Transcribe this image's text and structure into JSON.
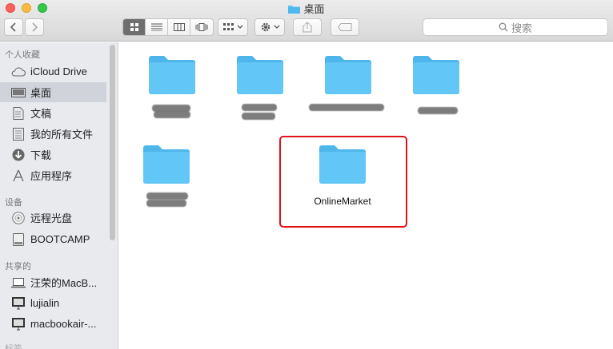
{
  "window": {
    "title": "桌面"
  },
  "toolbar": {
    "back_icon": "chevron-left-icon",
    "forward_icon": "chevron-right-icon",
    "view_icons": [
      "icon-view-icon",
      "list-view-icon",
      "column-view-icon",
      "cover-flow-icon"
    ],
    "arrange_icon": "arrange-grid-icon",
    "action_icon": "gear-icon",
    "share_icon": "share-icon",
    "tag_icon": "tag-icon",
    "search_placeholder": "搜索"
  },
  "sidebar": {
    "favorites_heading": "个人收藏",
    "favorites": [
      {
        "label": "iCloud Drive",
        "icon": "cloud-icon"
      },
      {
        "label": "桌面",
        "icon": "desktop-icon",
        "selected": true
      },
      {
        "label": "文稿",
        "icon": "document-icon"
      },
      {
        "label": "我的所有文件",
        "icon": "all-files-icon"
      },
      {
        "label": "下载",
        "icon": "download-icon"
      },
      {
        "label": "应用程序",
        "icon": "applications-icon"
      }
    ],
    "devices_heading": "设备",
    "devices": [
      {
        "label": "远程光盘",
        "icon": "disc-icon"
      },
      {
        "label": "BOOTCAMP",
        "icon": "drive-icon"
      }
    ],
    "shared_heading": "共享的",
    "shared": [
      {
        "label": "汪荣的MacB...",
        "icon": "laptop-icon"
      },
      {
        "label": "lujialin",
        "icon": "monitor-icon"
      },
      {
        "label": "macbookair-...",
        "icon": "monitor-icon"
      }
    ],
    "tags_heading_partial": "标签"
  },
  "content": {
    "folders": [
      {
        "name": "",
        "redacted": true
      },
      {
        "name": "",
        "redacted": true
      },
      {
        "name": "",
        "redacted": true
      },
      {
        "name": "",
        "redacted": true
      },
      {
        "name": "",
        "redacted": true
      },
      {
        "name": "OnlineMarket",
        "redacted": false,
        "highlighted": true
      }
    ]
  },
  "colors": {
    "folder": "#5bc4f5",
    "highlight": "#e0131a",
    "selection": "#d0d4da"
  }
}
